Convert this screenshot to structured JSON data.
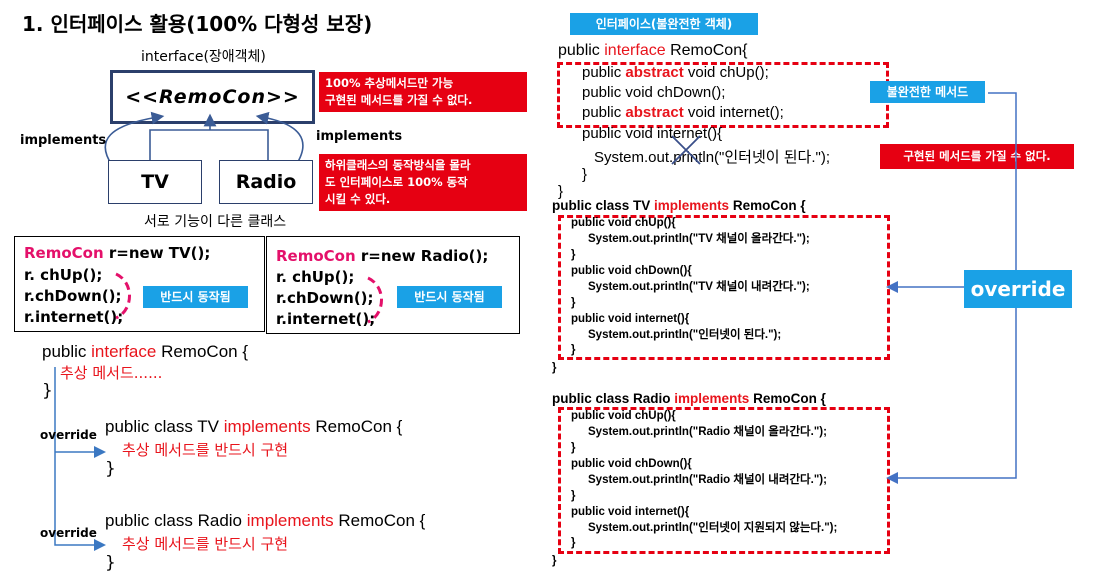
{
  "title": "1. 인터페이스 활용(100% 다형성 보장)",
  "left": {
    "interface_caption": "interface(장애객체)",
    "remocon_box": "<<RemoCon>>",
    "implements_left": "implements",
    "implements_right": "implements",
    "tv_box": "TV",
    "radio_box": "Radio",
    "classes_caption": "서로 기능이 다른 클래스",
    "note_abstract": [
      "100% 추상메서드만 가능",
      "구현된 메서드를 가질 수 없다."
    ],
    "note_subclass": [
      "하위클래스의 동작방식을 몰라",
      "도 인터페이스로 100% 동작",
      "시킬 수 있다."
    ],
    "code_tv": {
      "type": "RemoCon",
      "decl": " r=new TV();",
      "lines": [
        "r. chUp();",
        "r.chDown();",
        "r.internet();"
      ],
      "badge": "반드시 동작됨"
    },
    "code_radio": {
      "type": "RemoCon",
      "decl": " r=new Radio();",
      "lines": [
        "r. chUp();",
        "r.chDown();",
        "r.internet();"
      ],
      "badge": "반드시 동작됨"
    },
    "outline": {
      "iface_pre": "public ",
      "iface_kw": "interface",
      "iface_post": " RemoCon {",
      "iface_body": "추상 메서드......",
      "close": "}",
      "override1": "override",
      "override2": "override",
      "tv_pre": "public class TV ",
      "tv_kw": "implements",
      "tv_post": " RemoCon {",
      "tv_body": "추상 메서드를 반드시 구현",
      "radio_pre": "public class Radio ",
      "radio_kw": "implements",
      "radio_post": " RemoCon {",
      "radio_body": "추상 메서드를 반드시 구현"
    }
  },
  "right": {
    "badge_incomplete_object": "인터페이스(불완전한 객체)",
    "iface_pre": "public ",
    "iface_kw": "interface",
    "iface_post": " RemoCon{",
    "m1_pre": "public ",
    "m1_kw": "abstract",
    "m1_post": " void chUp();",
    "m2": "public void chDown();",
    "m3_pre": "public ",
    "m3_kw": "abstract",
    "m3_post": " void internet();",
    "impl1": "public void internet(){",
    "impl2": "System.out.println(\"인터넷이 된다.\");",
    "impl3": "}",
    "iface_close": "}",
    "badge_incomplete_method": "불완전한 메서드",
    "note_cannot": "구현된 메서드를 가질 수 없다.",
    "override_label": "override",
    "tv_head_pre": "public class TV ",
    "tv_head_kw": "implements",
    "tv_head_post": " RemoCon {",
    "tv_lines": [
      "public void chUp(){",
      "System.out.println(\"TV 채널이 올라간다.\");",
      "}",
      "public void chDown(){",
      "System.out.println(\"TV 채널이 내려간다.\");",
      "}",
      "public void internet(){",
      "System.out.println(\"인터넷이 된다.\");",
      "}"
    ],
    "tv_close": "}",
    "radio_head_pre": "public class Radio ",
    "radio_head_kw": "implements",
    "radio_head_post": " RemoCon {",
    "radio_lines": [
      "public void chUp(){",
      "System.out.println(\"Radio 채널이 올라간다.\");",
      "}",
      "public void chDown(){",
      "System.out.println(\"Radio 채널이 내려간다.\");",
      "}",
      "public void internet(){",
      "System.out.println(\"인터넷이 지원되지 않는다.\");",
      "}"
    ],
    "radio_close": "}"
  }
}
